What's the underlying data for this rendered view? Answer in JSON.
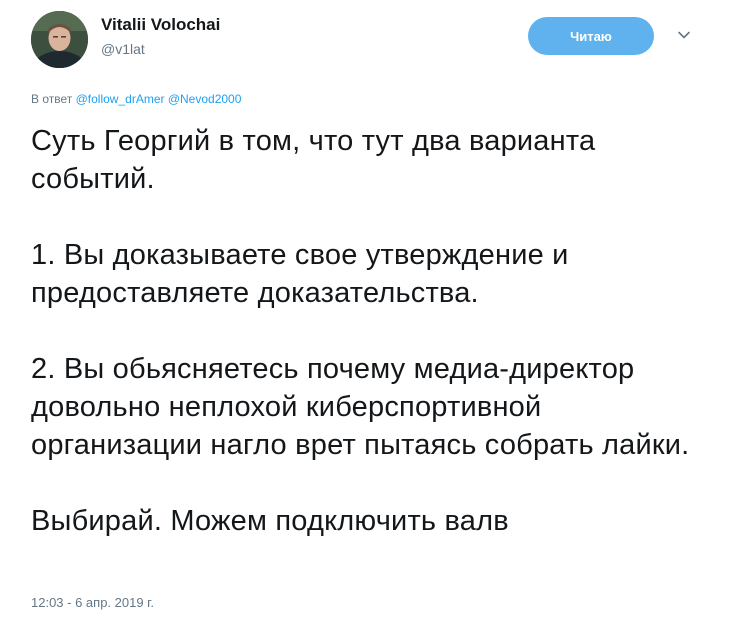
{
  "author": {
    "name": "Vitalii Volochai",
    "handle": "@v1lat"
  },
  "follow_button": {
    "label": "Читаю",
    "color": "#5fb2ee"
  },
  "menu": {
    "icon": "chevron-down-icon"
  },
  "reply": {
    "prefix": "В ответ",
    "mentions": [
      "@follow_drAmer",
      "@Nevod2000"
    ]
  },
  "tweet": {
    "paragraphs": [
      "Суть Георгий в том, что тут два варианта событий.",
      "1. Вы доказываете свое утверждение и предоставляете доказательства.",
      "2. Вы обьясняетесь почему медиа-директор довольно неплохой киберспортивной организации нагло врет пытаясь собрать лайки.",
      "Выбирай. Можем подключить валв"
    ]
  },
  "timestamp": "12:03 - 6 апр. 2019 г.",
  "colors": {
    "link": "#1da1f2",
    "muted": "#657786",
    "text": "#14171a"
  }
}
